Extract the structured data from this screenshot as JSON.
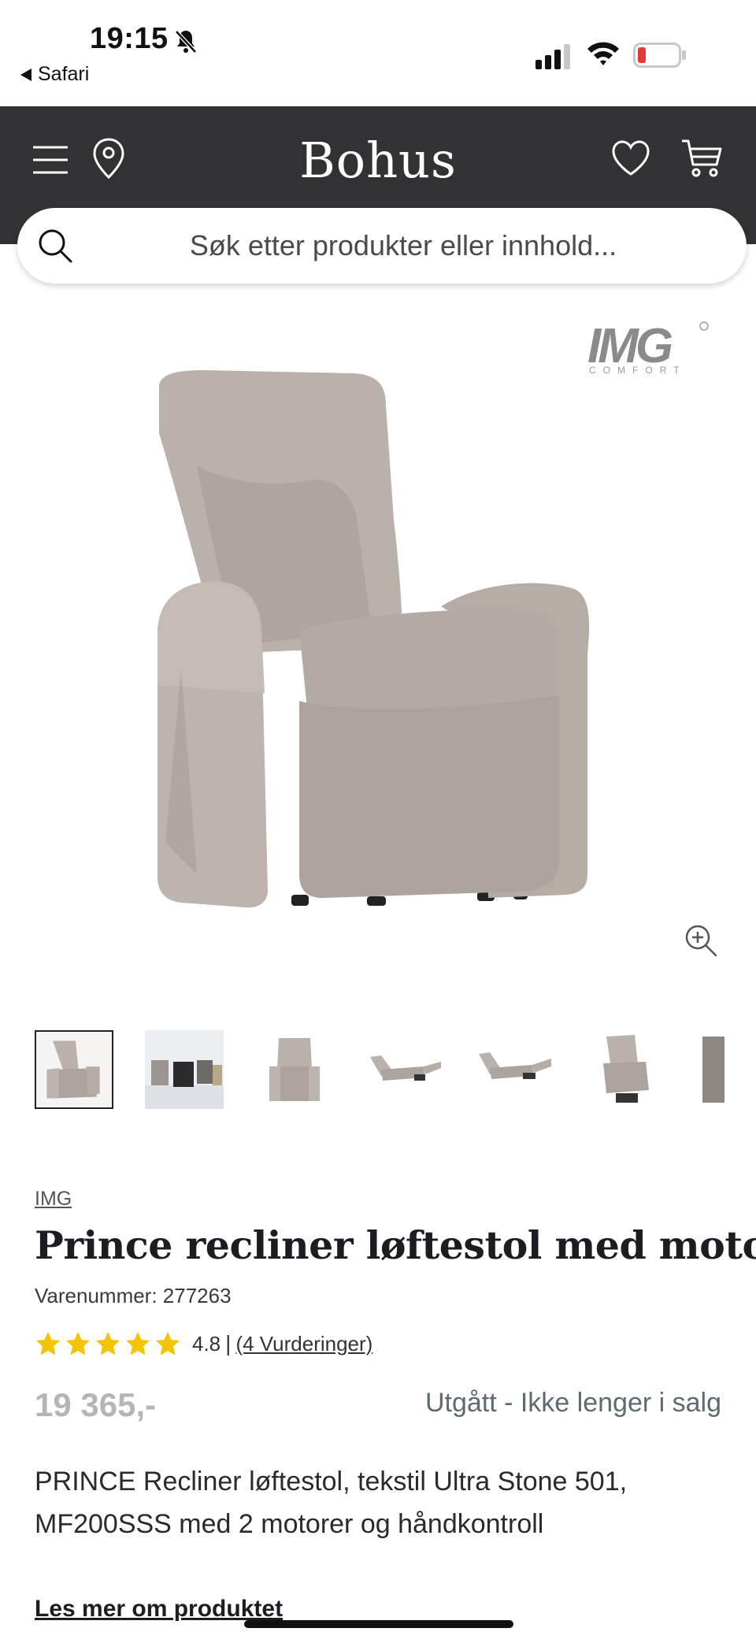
{
  "status_bar": {
    "time": "19:15",
    "back_app": "Safari",
    "battery_color": "#e53935"
  },
  "header": {
    "logo": "Bohus",
    "background": "#323236"
  },
  "search": {
    "placeholder": "Søk etter produkter eller innhold..."
  },
  "gallery": {
    "brand_logo_text": "IMG",
    "brand_logo_sub": "COMFORT",
    "thumbnail_count": 7,
    "active_thumbnail": 1,
    "thumbnails": [
      "chair-front",
      "chairs-showroom",
      "chair-straight",
      "chair-reclined",
      "chair-reclined-side",
      "chair-lift",
      "fabric-swatch"
    ]
  },
  "product": {
    "brand": "IMG",
    "title": "Prince recliner løftestol med motor",
    "sku": "Varenummer: 277263",
    "rating_value": "4.8",
    "rating_sep": "|",
    "stars": 5,
    "reviews": "(4 Vurderinger)",
    "price": "19 365,-",
    "status": "Utgått - Ikke lenger i salg",
    "description": "PRINCE Recliner løftestol, tekstil Ultra Stone 501, MF200SSS med 2 motorer og håndkontroll",
    "read_more": "Les mer om produktet",
    "star_color": "#f5c400"
  }
}
